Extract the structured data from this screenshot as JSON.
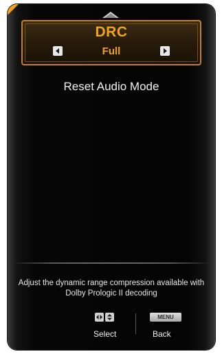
{
  "colors": {
    "accent": "#f2a21d",
    "highlight_border": "#c9801c",
    "panel_bg": "#060606",
    "text": "#f2f2f2"
  },
  "menu": {
    "scroll_up_icon": "up-arrow-icon",
    "selected_item": {
      "title": "DRC",
      "value": "Full",
      "left_icon": "left-arrow-icon",
      "right_icon": "right-arrow-icon"
    },
    "items": [
      {
        "label": "Reset Audio Mode"
      }
    ]
  },
  "help": {
    "text": "Adjust the dynamic range compression available with Dolby Prologic II decoding"
  },
  "footer": {
    "select_keys": [
      "left-right-arrow-icon",
      "up-down-arrow-icon"
    ],
    "select_label": "Select",
    "menu_key": "MENU",
    "back_label": "Back"
  }
}
